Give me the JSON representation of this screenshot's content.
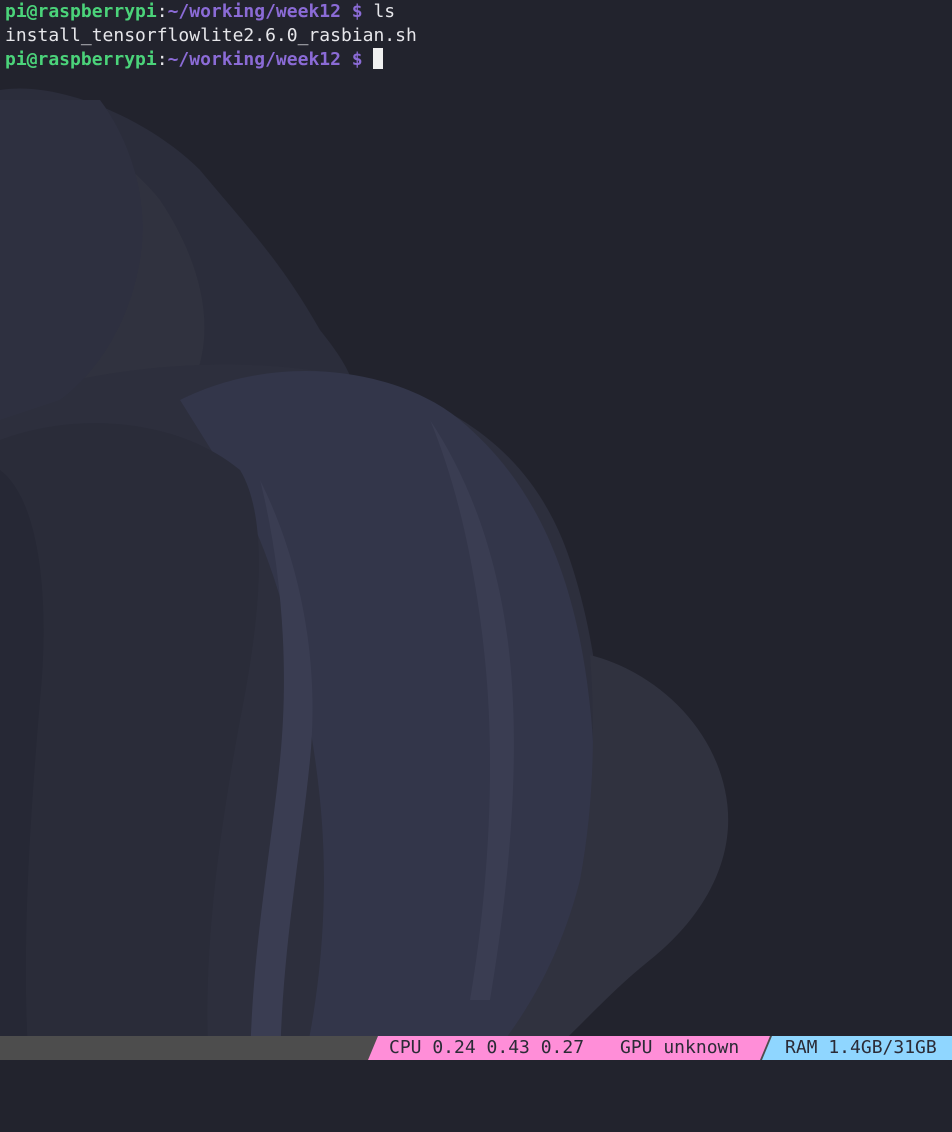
{
  "colors": {
    "background": "#22232d",
    "user_host": "#4bd37a",
    "path": "#8b6bd6",
    "text": "#e6e6ea",
    "status_bg": "#4d4d4d",
    "cpu_gpu_segment": "#ff8ed8",
    "ram_segment": "#8fd6ff"
  },
  "terminal": {
    "lines": [
      {
        "user_host": "pi@raspberrypi",
        "separator": ":",
        "path": "~/working/week12",
        "prompt": " $ ",
        "command": "ls"
      },
      {
        "output": "install_tensorflowlite2.6.0_rasbian.sh"
      },
      {
        "user_host": "pi@raspberrypi",
        "separator": ":",
        "path": "~/working/week12",
        "prompt": " $ ",
        "command": ""
      }
    ]
  },
  "statusbar": {
    "cpu": "CPU 0.24 0.43 0.27",
    "gpu": "GPU unknown",
    "ram": "RAM 1.4GB/31GB"
  }
}
